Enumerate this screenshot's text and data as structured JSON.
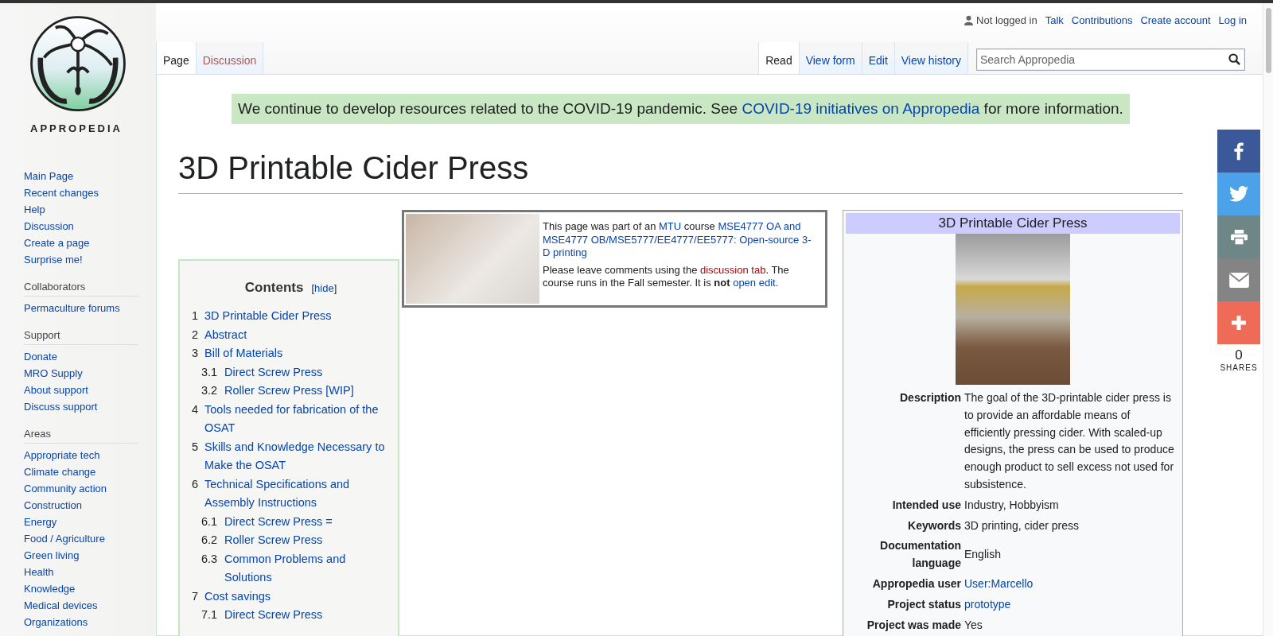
{
  "logo": {
    "wordmark": "APPROPEDIA"
  },
  "sidebar": {
    "sections": [
      {
        "items": [
          "Main Page",
          "Recent changes",
          "Help",
          "Discussion",
          "Create a page",
          "Surprise me!"
        ]
      },
      {
        "heading": "Collaborators",
        "items": [
          "Permaculture forums"
        ]
      },
      {
        "heading": "Support",
        "items": [
          "Donate",
          "MRO Supply",
          "About support",
          "Discuss support"
        ]
      },
      {
        "heading": "Areas",
        "items": [
          "Appropriate tech",
          "Climate change",
          "Community action",
          "Construction",
          "Energy",
          "Food / Agriculture",
          "Green living",
          "Health",
          "Knowledge",
          "Medical devices",
          "Organizations"
        ]
      }
    ]
  },
  "personal_tools": {
    "status": "Not logged in",
    "links": [
      "Talk",
      "Contributions",
      "Create account",
      "Log in"
    ]
  },
  "namespace_tabs": [
    {
      "label": "Page",
      "selected": true,
      "missing": false
    },
    {
      "label": "Discussion",
      "selected": false,
      "missing": true
    }
  ],
  "view_tabs": [
    {
      "label": "Read",
      "selected": true
    },
    {
      "label": "View form",
      "selected": false
    },
    {
      "label": "Edit",
      "selected": false
    },
    {
      "label": "View history",
      "selected": false
    }
  ],
  "search": {
    "placeholder": "Search Appropedia"
  },
  "banner": [
    {
      "kind": "text",
      "text": "We continue to develop resources related to the COVID-19 pandemic. See "
    },
    {
      "kind": "link",
      "text": "COVID-19 initiatives on Appropedia"
    },
    {
      "kind": "text",
      "text": " for more information."
    }
  ],
  "page_title": "3D Printable Cider Press",
  "toc": {
    "title": "Contents",
    "toggle": {
      "open": "[",
      "label": "hide",
      "close": "]"
    },
    "items": [
      {
        "number": "1",
        "title": "3D Printable Cider Press"
      },
      {
        "number": "2",
        "title": "Abstract"
      },
      {
        "number": "3",
        "title": "Bill of Materials",
        "children": [
          {
            "number": "3.1",
            "title": "Direct Screw Press"
          },
          {
            "number": "3.2",
            "title": "Roller Screw Press [WIP]"
          }
        ]
      },
      {
        "number": "4",
        "title": "Tools needed for fabrication of the OSAT"
      },
      {
        "number": "5",
        "title": "Skills and Knowledge Necessary to Make the OSAT"
      },
      {
        "number": "6",
        "title": "Technical Specifications and Assembly Instructions",
        "children": [
          {
            "number": "6.1",
            "title": "Direct Screw Press ="
          },
          {
            "number": "6.2",
            "title": "Roller Screw Press"
          },
          {
            "number": "6.3",
            "title": "Common Problems and Solutions"
          }
        ]
      },
      {
        "number": "7",
        "title": "Cost savings",
        "children": [
          {
            "number": "7.1",
            "title": "Direct Screw Press"
          }
        ]
      }
    ]
  },
  "course_notice": {
    "paragraphs": [
      [
        {
          "kind": "text",
          "text": "This page was part of an "
        },
        {
          "kind": "link",
          "text": "MTU"
        },
        {
          "kind": "text",
          "text": " course "
        },
        {
          "kind": "link",
          "text": "MSE4777 OA and"
        },
        {
          "kind": "link",
          "text": "MSE4777 OB/MSE5777/EE4777/EE5777: Open-source 3-",
          "space_before": true
        },
        {
          "kind": "link",
          "text": "D printing"
        }
      ],
      [
        {
          "kind": "text",
          "text": "Please leave comments using the "
        },
        {
          "kind": "newlink",
          "text": "discussion tab"
        },
        {
          "kind": "text",
          "text": ". The course runs in the Fall semester. It is **not** "
        },
        {
          "kind": "link",
          "text": "open edit"
        },
        {
          "kind": "text",
          "text": "."
        }
      ]
    ]
  },
  "infobox": {
    "title": "3D Printable Cider Press",
    "rows": [
      {
        "label": "Description",
        "value": "The goal of the 3D-printable cider press is to provide an affordable means of efficiently pressing cider. With scaled-up designs, the press can be used to produce enough product to sell excess not used for subsistence.",
        "kind": "text"
      },
      {
        "label": "Intended use",
        "value": "Industry, Hobbyism",
        "kind": "text"
      },
      {
        "label": "Keywords",
        "value": "3D printing, cider press",
        "kind": "text"
      },
      {
        "label": "Documentation language",
        "value": "English",
        "kind": "text"
      },
      {
        "label": "Appropedia user",
        "value": "User:Marcello",
        "kind": "link"
      },
      {
        "label": "Project status",
        "value": "prototype",
        "kind": "link"
      },
      {
        "label": "Project was made",
        "value": "Yes",
        "kind": "text"
      }
    ]
  },
  "share": {
    "buttons": [
      {
        "kind": "facebook",
        "color": "#3b5998"
      },
      {
        "kind": "twitter",
        "color": "#4ca2e9"
      },
      {
        "kind": "print",
        "color": "#6e8686"
      },
      {
        "kind": "email",
        "color": "#848484"
      },
      {
        "kind": "more",
        "color": "#ed6b57"
      }
    ],
    "count": "0",
    "label": "SHARES"
  }
}
